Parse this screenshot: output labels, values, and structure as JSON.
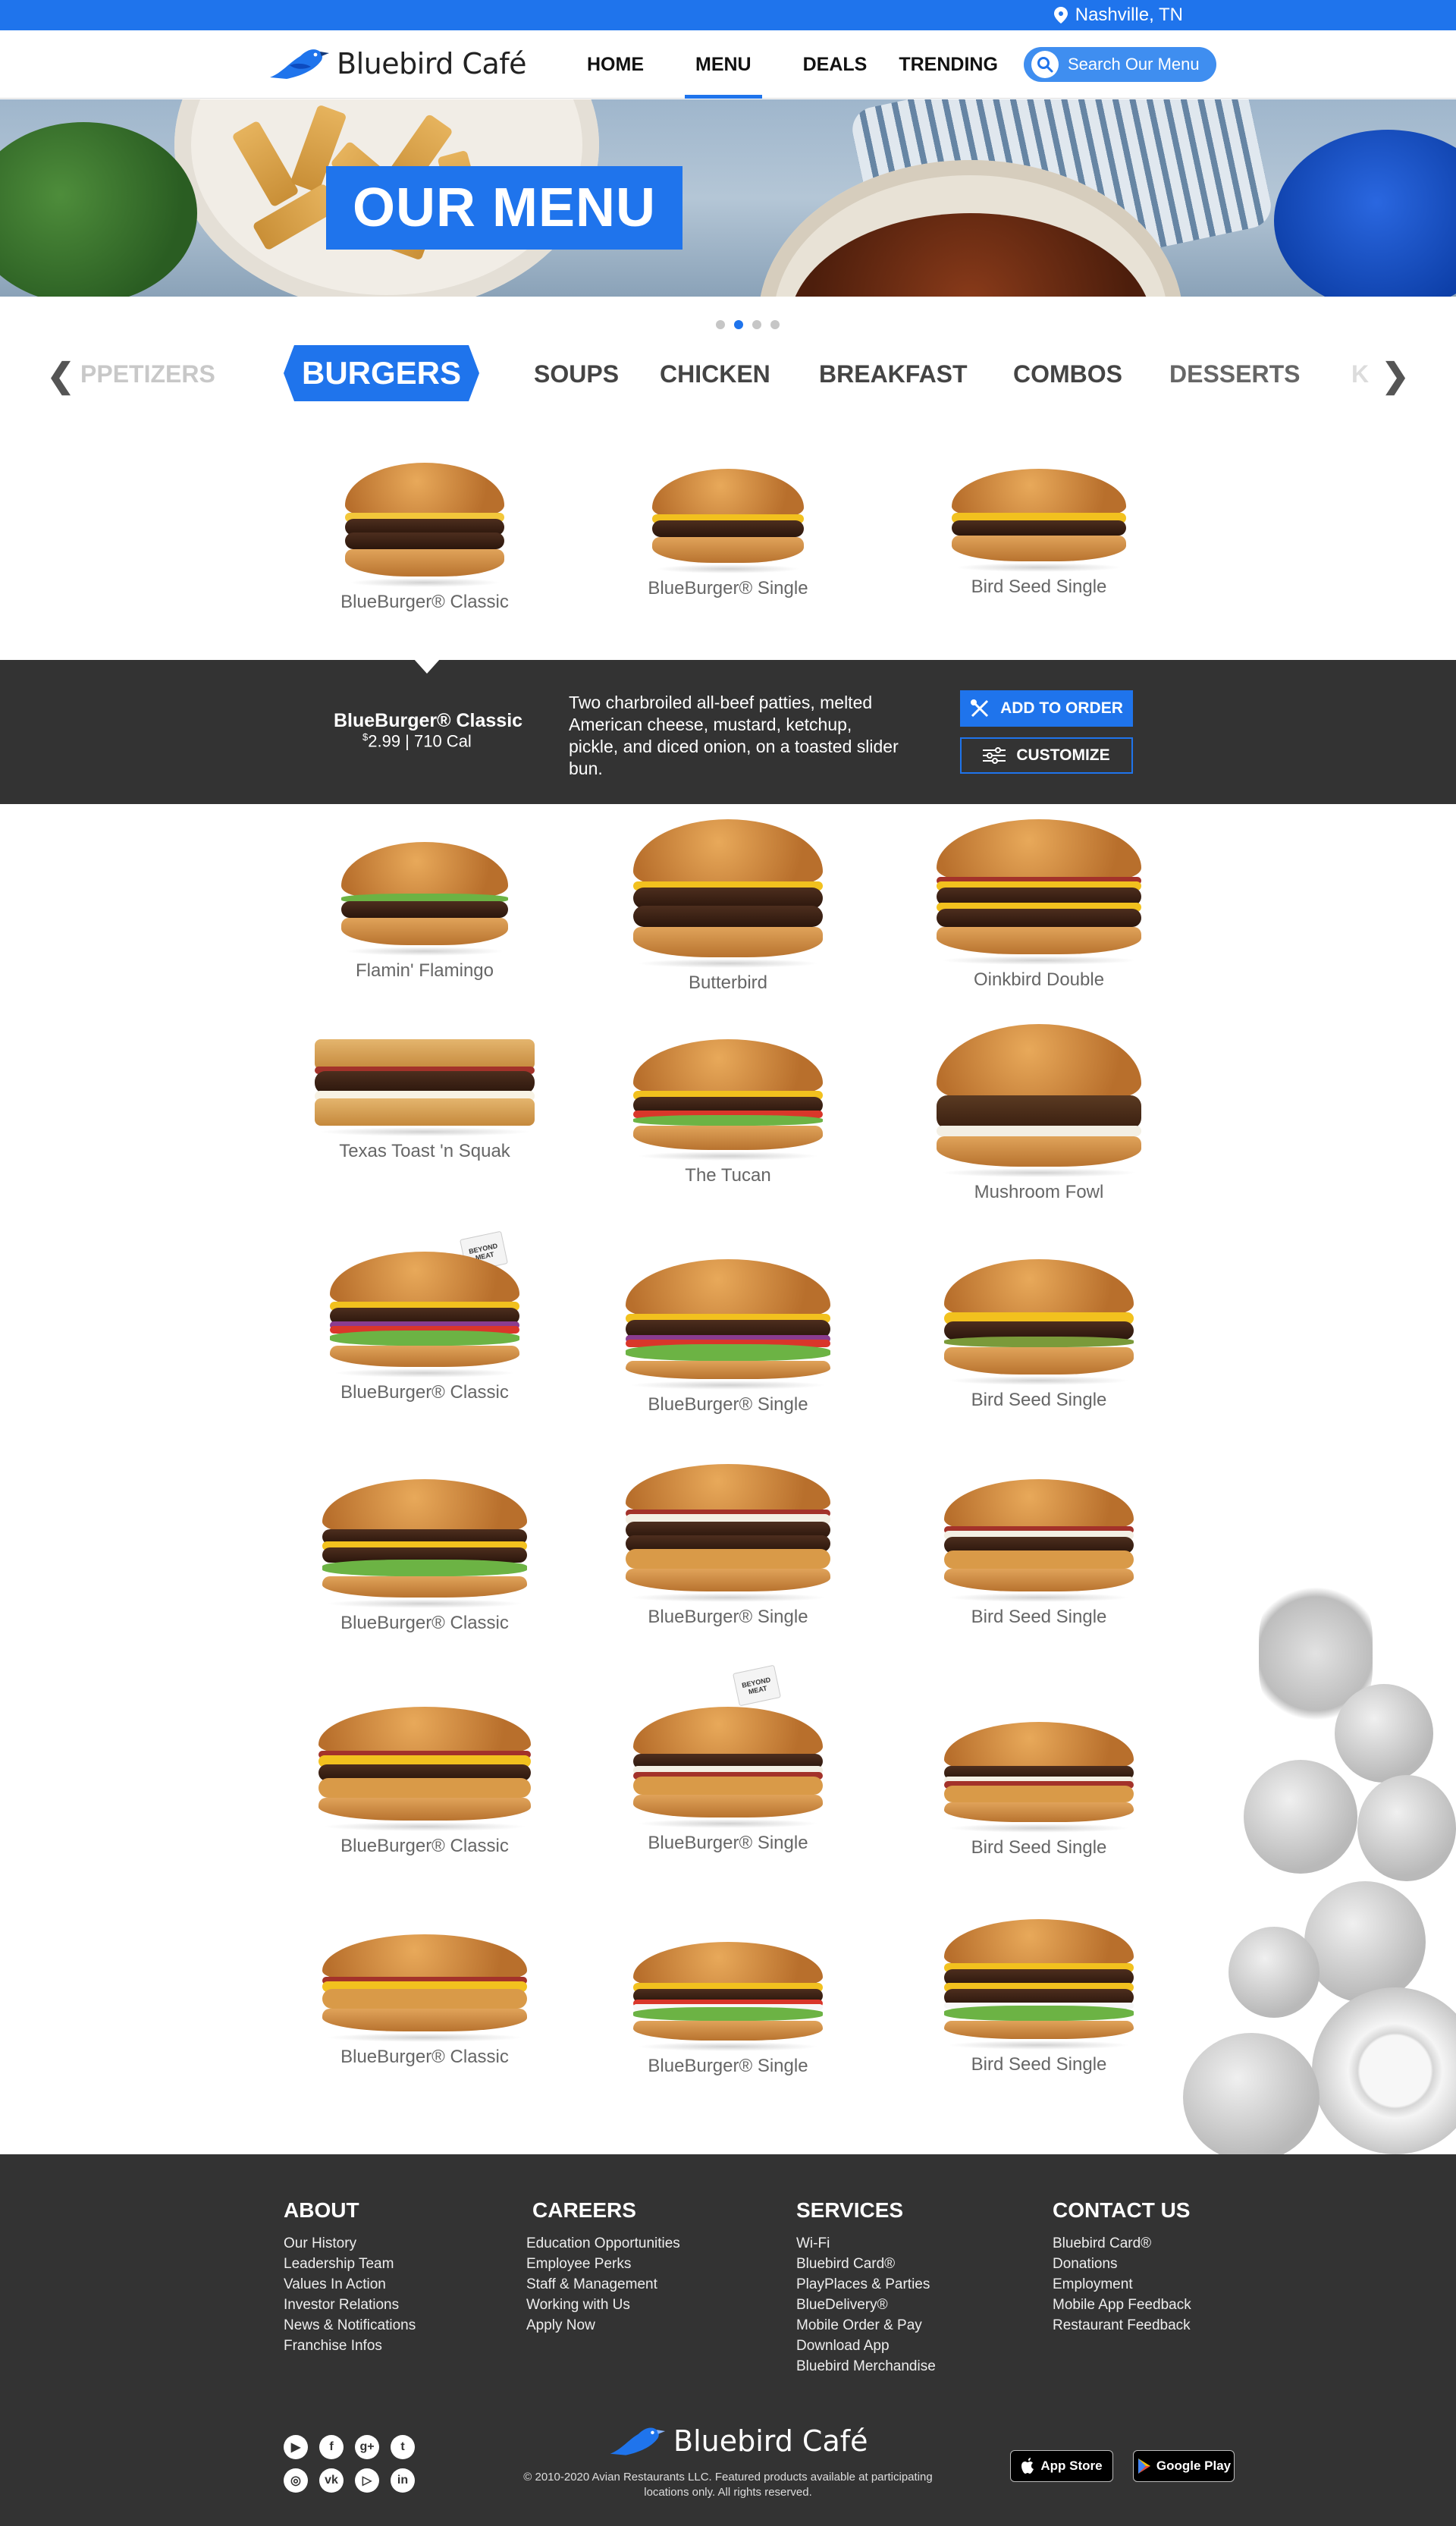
{
  "header": {
    "location": "Nashville, TN",
    "logo_text": "Bluebird Café",
    "nav": [
      "HOME",
      "MENU",
      "DEALS",
      "TRENDING"
    ],
    "active_nav": "MENU",
    "search_placeholder": "Search Our Menu"
  },
  "hero": {
    "title": "OUR MENU",
    "slides": 4,
    "active_slide": 2
  },
  "categories": {
    "items": [
      "APPETIZERS",
      "BURGERS",
      "SOUPS",
      "CHICKEN",
      "BREAKFAST",
      "COMBOS",
      "DESSERTS",
      "KIDS"
    ],
    "visible_labels": [
      "PPETIZERS",
      "BURGERS",
      "SOUPS",
      "CHICKEN",
      "BREAKFAST",
      "COMBOS",
      "DESSERTS",
      "K"
    ],
    "active": "BURGERS"
  },
  "menu_rows": [
    [
      "BlueBurger® Classic",
      "BlueBurger® Single",
      "Bird Seed Single"
    ],
    [
      "Flamin' Flamingo",
      "Butterbird",
      "Oinkbird Double"
    ],
    [
      "Texas Toast 'n Squak",
      "The Tucan",
      "Mushroom Fowl"
    ],
    [
      "BlueBurger® Classic",
      "BlueBurger® Single",
      "Bird Seed Single"
    ],
    [
      "BlueBurger® Classic",
      "BlueBurger® Single",
      "Bird Seed Single"
    ],
    [
      "BlueBurger® Classic",
      "BlueBurger® Single",
      "Bird Seed Single"
    ],
    [
      "BlueBurger® Classic",
      "BlueBurger® Single",
      "Bird Seed Single"
    ]
  ],
  "beyond_meat_flag": "BEYOND MEAT",
  "detail": {
    "name": "BlueBurger® Classic",
    "price_symbol": "$",
    "price": "2.99 | 710 Cal",
    "description": "Two charbroiled all-beef patties, melted American cheese, mustard, ketchup, pickle, and diced onion, on a toasted slider bun.",
    "add_to_order": "ADD TO ORDER",
    "customize": "CUSTOMIZE"
  },
  "footer": {
    "columns": [
      {
        "title": "ABOUT",
        "links": [
          "Our History",
          "Leadership Team",
          "Values In Action",
          "Investor Relations",
          "News & Notifications",
          "Franchise Infos"
        ]
      },
      {
        "title": "CAREERS",
        "links": [
          "Education Opportunities",
          "Employee Perks",
          "Staff & Management",
          "Working with Us",
          "Apply Now"
        ]
      },
      {
        "title": "SERVICES",
        "links": [
          "Wi-Fi",
          "Bluebird Card®",
          "PlayPlaces & Parties",
          "BlueDelivery®",
          "Mobile Order & Pay",
          "Download App",
          "Bluebird Merchandise"
        ]
      },
      {
        "title": "CONTACT US",
        "links": [
          "Bluebird Card®",
          "Donations",
          "Employment",
          "Mobile App Feedback",
          "Restaurant Feedback"
        ]
      }
    ],
    "logo_text": "Bluebird Café",
    "copyright": "© 2010-2020 Avian Restaurants LLC. Featured products available at participating locations only. All rights reserved.",
    "app_store": "App Store",
    "google_play": "Google Play",
    "socials": [
      "youtube-icon",
      "facebook-icon",
      "google-plus-icon",
      "twitter-icon",
      "instagram-icon",
      "vk-icon",
      "youtube-play-icon",
      "linkedin-icon"
    ]
  },
  "colors": {
    "brand_blue": "#1f74ec",
    "dark_band": "#333333"
  }
}
